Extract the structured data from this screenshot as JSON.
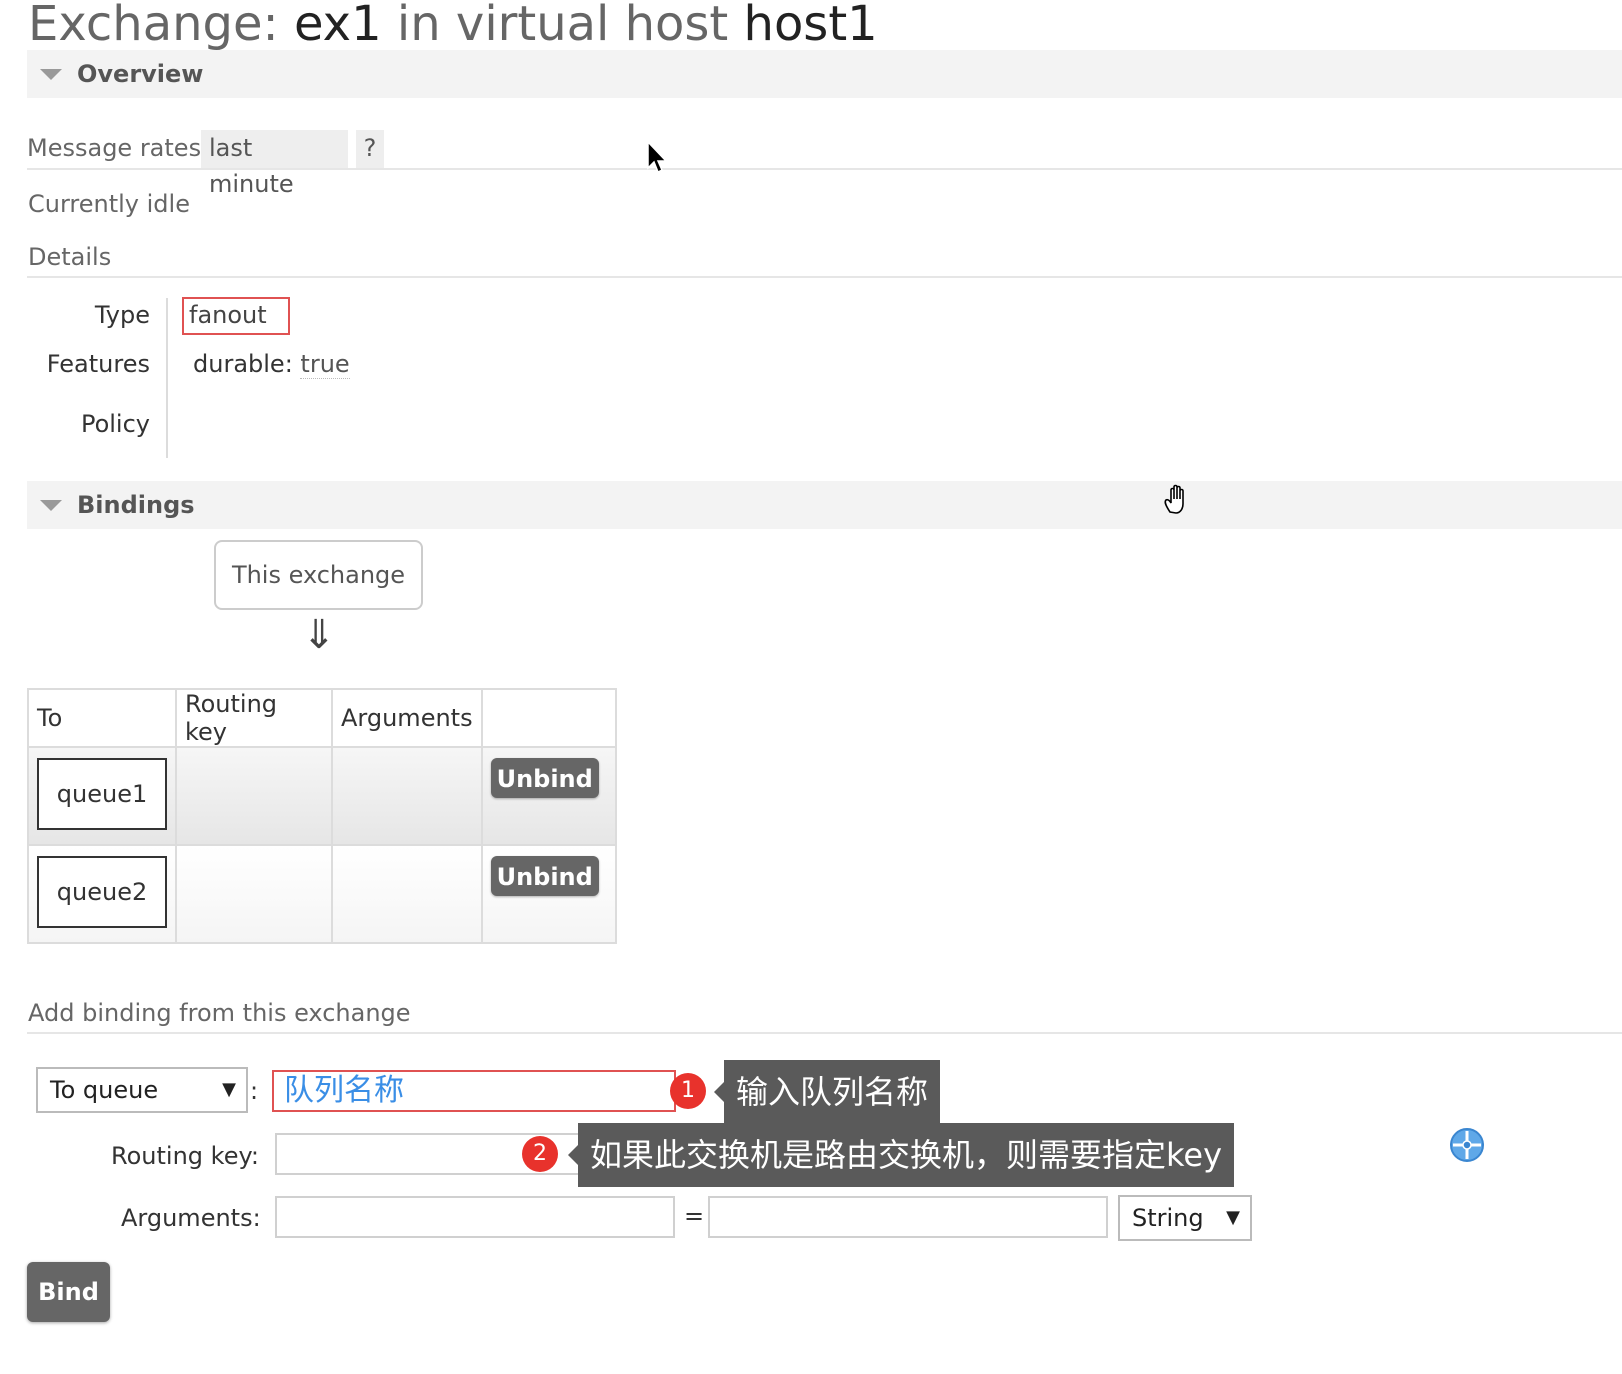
{
  "header": {
    "prefix": "Exchange:",
    "exchange_name": "ex1",
    "middle": "in virtual host",
    "vhost": "host1"
  },
  "overview": {
    "section_label": "Overview",
    "message_rates_label": "Message rates",
    "rate_period": "last minute",
    "help": "?",
    "status": "Currently idle",
    "details_label": "Details",
    "type_label": "Type",
    "type_value": "fanout",
    "features_label": "Features",
    "features_key": "durable:",
    "features_value": "true",
    "policy_label": "Policy"
  },
  "bindings": {
    "section_label": "Bindings",
    "this_exchange": "This exchange",
    "arrow": "⇓",
    "columns": [
      "To",
      "Routing key",
      "Arguments",
      ""
    ],
    "rows": [
      {
        "to": "queue1",
        "routing_key": "",
        "arguments": "",
        "action": "Unbind"
      },
      {
        "to": "queue2",
        "routing_key": "",
        "arguments": "",
        "action": "Unbind"
      }
    ]
  },
  "add_binding": {
    "title": "Add binding from this exchange",
    "destination_type": "To queue",
    "colon": ":",
    "destination_value": "队列名称",
    "routing_key_label": "Routing key:",
    "routing_key_value": "",
    "arguments_label": "Arguments:",
    "arg_key_value": "",
    "equals": "=",
    "arg_value_value": "",
    "arg_type": "String",
    "bind_button": "Bind"
  },
  "annotations": [
    {
      "number": "1",
      "text": "输入队列名称"
    },
    {
      "number": "2",
      "text": "如果此交换机是路由交换机，则需要指定key"
    }
  ],
  "colors": {
    "button_bg": "#666666",
    "highlight_border": "#e05252",
    "badge": "#e8322c",
    "tooltip_bg": "#5a5a5a",
    "placeholder_text": "#3a8ee6"
  }
}
